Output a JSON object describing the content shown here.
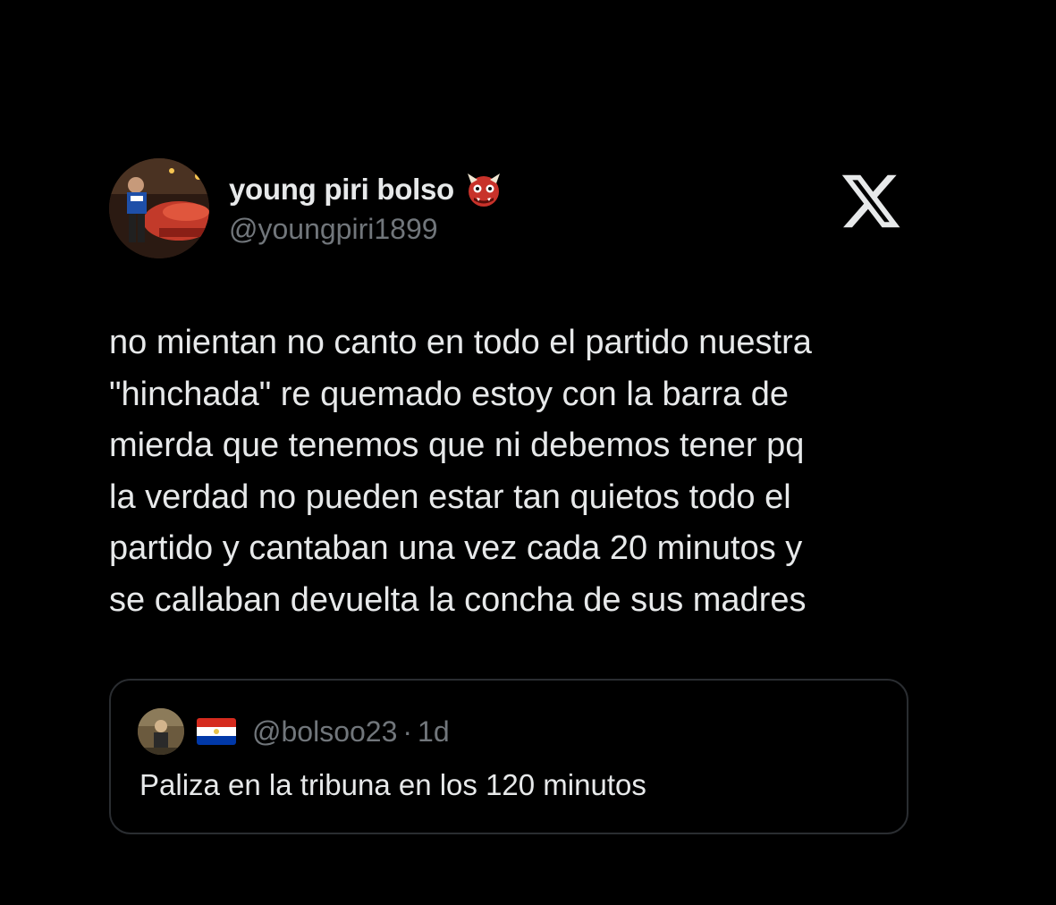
{
  "author": {
    "display_name": "young piri bolso",
    "name_emoji": "ogre-icon",
    "handle": "@youngpiri1899"
  },
  "platform_logo": "x-logo-icon",
  "tweet": {
    "lines": [
      "no mientan no canto en todo el partido nuestra",
      "\"hinchada\" re quemado estoy con la barra de",
      "mierda que tenemos que ni debemos tener pq",
      "la verdad no pueden estar tan quietos todo el",
      "partido y cantaban una vez cada 20 minutos y",
      "se callaban devuelta la concha de sus madres"
    ]
  },
  "quoted_tweet": {
    "flag": "paraguay-flag-icon",
    "handle": "@bolsoo23",
    "separator": "·",
    "time": "1d",
    "text": "Paliza en la tribuna en los 120 minutos"
  },
  "colors": {
    "background": "#000000",
    "primary_text": "#e7e9ea",
    "secondary_text": "#71767b",
    "card_border": "#2a2d31"
  }
}
